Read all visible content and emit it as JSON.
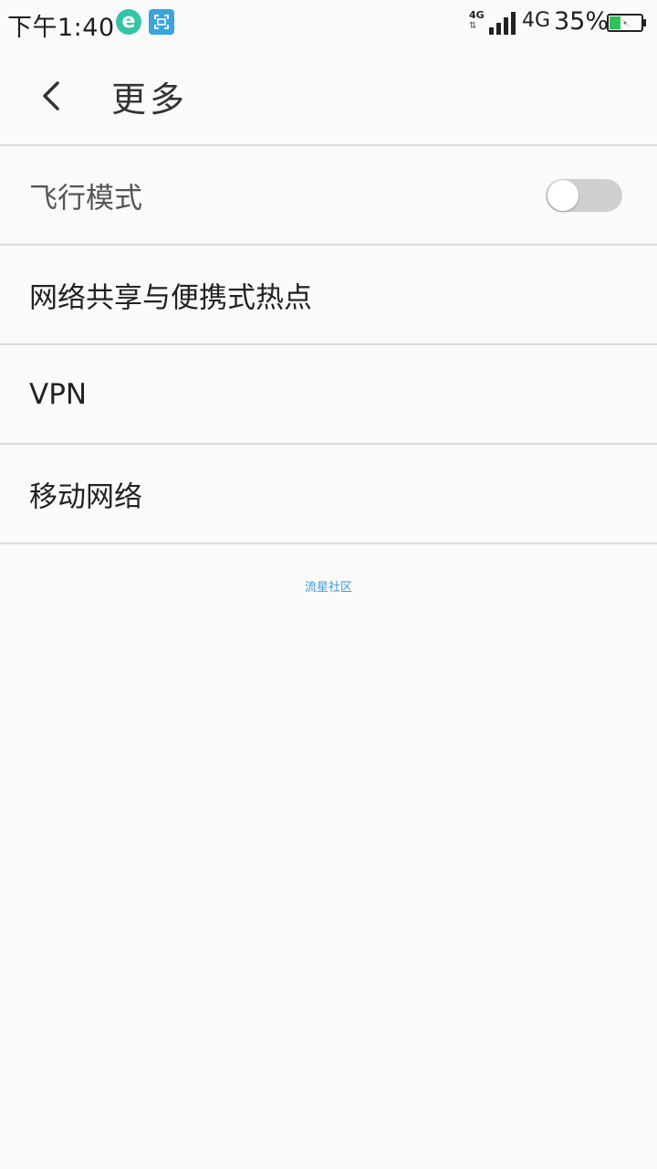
{
  "status_bar": {
    "time": "下午1:40",
    "app_icons": [
      "browser-e-icon",
      "screenshot-icon"
    ],
    "network_small_label": "4G",
    "network_label": "4G",
    "battery_percent": "35%",
    "battery_level": 0.35,
    "battery_charging": true
  },
  "header": {
    "back_icon": "chevron-left-icon",
    "title": "更多"
  },
  "settings": {
    "items": [
      {
        "label": "飞行模式",
        "has_toggle": true,
        "toggle_on": false
      },
      {
        "label": "网络共享与便携式热点"
      },
      {
        "label": "VPN"
      },
      {
        "label": "移动网络"
      }
    ]
  },
  "footer": {
    "link_text": "流星社区"
  },
  "colors": {
    "background": "#fafafa",
    "divider": "#dcdcdc",
    "toggle_off": "#cfcfcf",
    "link": "#3a9ad9",
    "battery_fill": "#2fbf5b"
  }
}
